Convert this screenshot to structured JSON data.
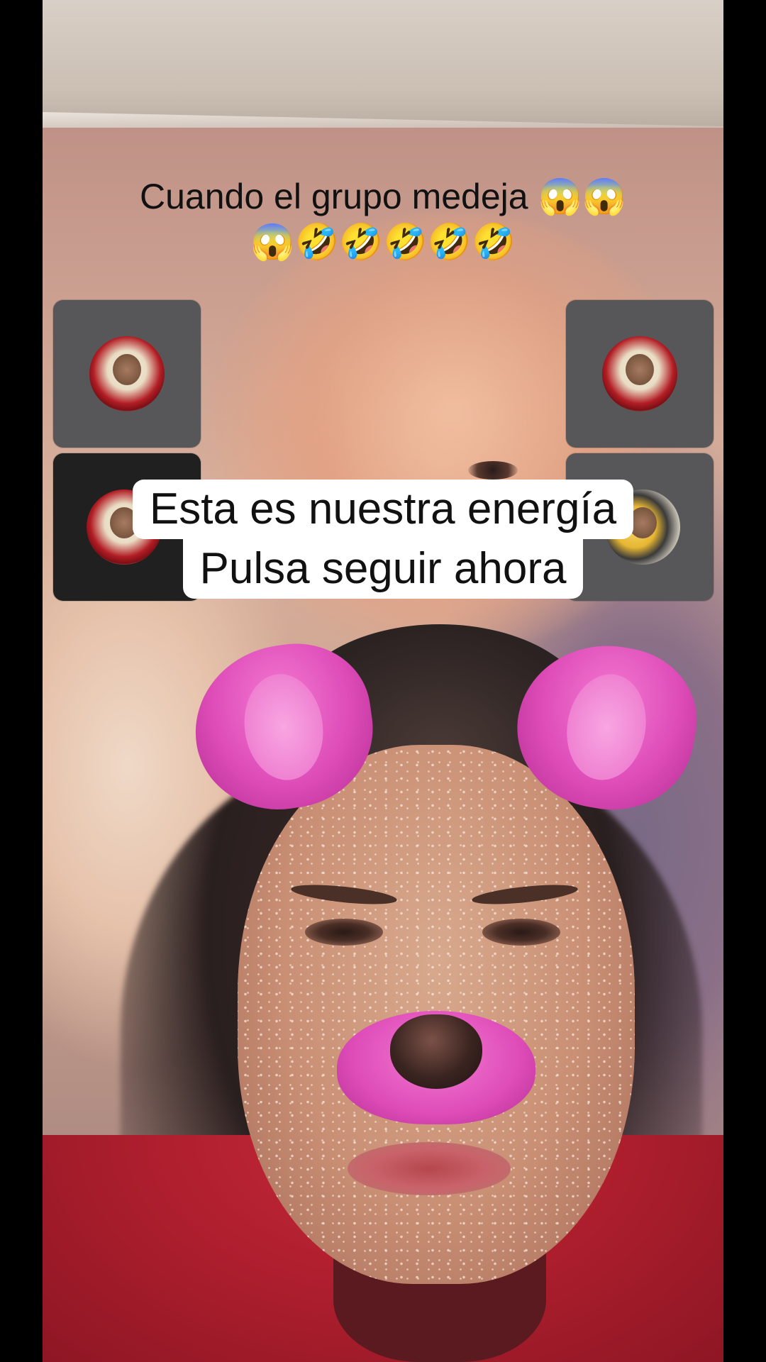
{
  "caption": {
    "line1": "Cuando el grupo medeja 😱😱",
    "line2": "😱🤣🤣🤣🤣🤣"
  },
  "subtitle": {
    "line1": "Esta es nuestra energía",
    "line2": "Pulsa seguir ahora"
  },
  "participants": [
    {
      "name": "participant-tile-1"
    },
    {
      "name": "participant-tile-2"
    },
    {
      "name": "participant-tile-3"
    },
    {
      "name": "participant-tile-4"
    }
  ],
  "colors": {
    "filter_pink": "#de4cb8",
    "subtitle_bg": "#ffffff",
    "shirt_red": "#b01f2e"
  }
}
